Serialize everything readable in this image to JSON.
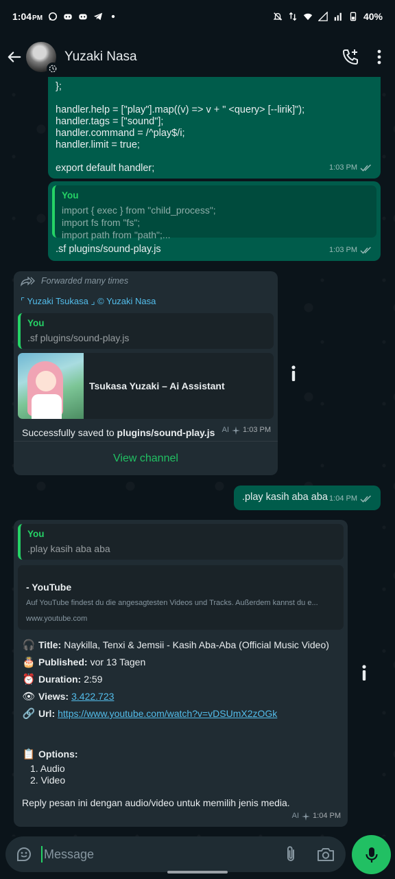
{
  "status_bar": {
    "time": "1:04",
    "time_suffix": "PM",
    "battery": "40%"
  },
  "header": {
    "contact_name": "Yuzaki Nasa"
  },
  "messages": {
    "code": {
      "lines": [
        "};",
        "",
        "handler.help = [\"play\"].map((v) => v + \" <query> [--lirik]\");",
        "handler.tags = [\"sound\"];",
        "handler.command = /^play$/i;",
        "handler.limit = true;",
        "",
        "export default handler;"
      ],
      "time": "1:03 PM"
    },
    "save_cmd": {
      "quote_name": "You",
      "quote_lines": [
        "import { exec } from \"child_process\";",
        "import fs from \"fs\";",
        "import path from \"path\";..."
      ],
      "text": ".sf plugins/sound-play.js",
      "time": "1:03 PM"
    },
    "bot_reply": {
      "forwarded": "Forwarded many times",
      "channel": "⌜ Yuzaki Tsukasa ⌟ © Yuzaki Nasa",
      "quote_name": "You",
      "quote_text": ".sf plugins/sound-play.js",
      "card_title": "Tsukasa Yuzaki – Ai Assistant",
      "text_prefix": "Successfully saved to ",
      "text_bold": "plugins/sound-play.js",
      "ai": "AI",
      "time": "1:03 PM",
      "view_channel": "View channel"
    },
    "play_cmd": {
      "text": ".play kasih aba aba",
      "time": "1:04 PM"
    },
    "yt_reply": {
      "quote_name": "You",
      "quote_text": ".play kasih aba aba",
      "card_title": "- YouTube",
      "card_desc": "Auf YouTube findest du die angesagtesten Videos und Tracks. Außerdem kannst du e...",
      "card_domain": "www.youtube.com",
      "title_label": "Title:",
      "title_value": "Naykilla, Tenxi & Jemsii - Kasih Aba-Aba (Official Music Video)",
      "published_label": "Published:",
      "published_value": "vor 13 Tagen",
      "duration_label": "Duration:",
      "duration_value": "2:59",
      "views_label": "Views:",
      "views_value": "3.422.723",
      "url_label": "Url:",
      "url_value": "https://www.youtube.com/watch?v=vDSUmX2zOGk",
      "options_label": "Options:",
      "options": [
        "1. Audio",
        "2. Video"
      ],
      "reply_hint": "Reply pesan ini dengan audio/video untuk memilih jenis media.",
      "ai": "AI",
      "time": "1:04 PM"
    }
  },
  "composer": {
    "placeholder": "Message"
  },
  "colors": {
    "outgoing": "#005c4b",
    "incoming": "#202c33",
    "accent": "#25d366",
    "link": "#53bdeb"
  }
}
